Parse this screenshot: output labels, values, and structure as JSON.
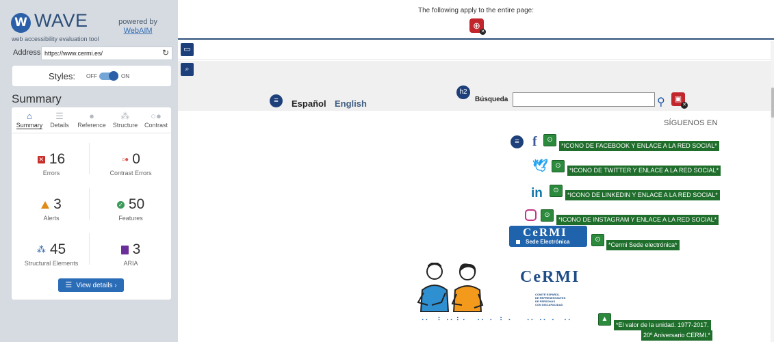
{
  "wave": {
    "title": "WAVE",
    "tagline": "web accessibility evaluation tool",
    "powered_by": "powered by",
    "powered_link": "WebAIM",
    "address_label": "Address:",
    "address_value": "https://www.cermi.es/",
    "styles_label": "Styles:",
    "styles_off": "OFF",
    "styles_on": "ON",
    "styles_state": "on",
    "summary_heading": "Summary",
    "tabs": [
      {
        "label": "Summary",
        "icon": "home-icon",
        "active": true
      },
      {
        "label": "Details",
        "icon": "list-icon",
        "active": false
      },
      {
        "label": "Reference",
        "icon": "info-icon",
        "active": false
      },
      {
        "label": "Structure",
        "icon": "structure-icon",
        "active": false
      },
      {
        "label": "Contrast",
        "icon": "contrast-icon",
        "active": false
      }
    ],
    "stats": {
      "errors": {
        "value": "16",
        "label": "Errors",
        "color": "#c9302c"
      },
      "contrast_errors": {
        "value": "0",
        "label": "Contrast Errors",
        "color": "#d9534f"
      },
      "alerts": {
        "value": "3",
        "label": "Alerts",
        "color": "#e08a17"
      },
      "features": {
        "value": "50",
        "label": "Features",
        "color": "#3c9a5a"
      },
      "structural": {
        "value": "45",
        "label": "Structural Elements",
        "color": "#2b5fa7"
      },
      "aria": {
        "value": "3",
        "label": "ARIA",
        "color": "#6b2f99"
      }
    },
    "view_details": "View details ›"
  },
  "page": {
    "entire_page_note": "The following apply to the entire page:",
    "nav": {
      "espanol": "Español",
      "english": "English"
    },
    "search_label": "Búsqueda",
    "search_value": "",
    "siguenos": "SÍGUENOS EN",
    "social": [
      {
        "icon": "facebook-icon",
        "alt_text": "*ICONO DE FACEBOOK Y ENLACE A LA RED SOCIAL*"
      },
      {
        "icon": "twitter-icon",
        "alt_text": "*ICONO DE TWITTER Y ENLACE A LA RED SOCIAL*"
      },
      {
        "icon": "linkedin-icon",
        "alt_text": "*ICONO DE LINKEDIN Y ENLACE A LA RED SOCIAL*"
      },
      {
        "icon": "instagram-icon",
        "alt_text": "*ICONO DE INSTAGRAM Y ENLACE A LA RED SOCIAL*"
      }
    ],
    "sede_banner": {
      "word": "CeRMI",
      "sub": "Sede Electrónica",
      "alt_text": "*Cermi Sede electrónica*"
    },
    "cermi_logo": {
      "word": "CeRMI",
      "sub_lines": [
        "COMITÉ ESPAÑOL",
        "DE REPRESENTANTES",
        "DE PERSONAS",
        "CON DISCAPACIDAD"
      ]
    },
    "braille_text": "⠐⠂⠀⠃⠐⠂⠃⠂⠀⠐⠂⠐⠀⠃⠐⠀⠀⠐⠂⠐⠂⠐⠀⠐⠂",
    "unity_alt_line1": "*El valor de la unidad. 1977-2017.",
    "unity_alt_line2": "20º Aniversario CERMI.*"
  }
}
